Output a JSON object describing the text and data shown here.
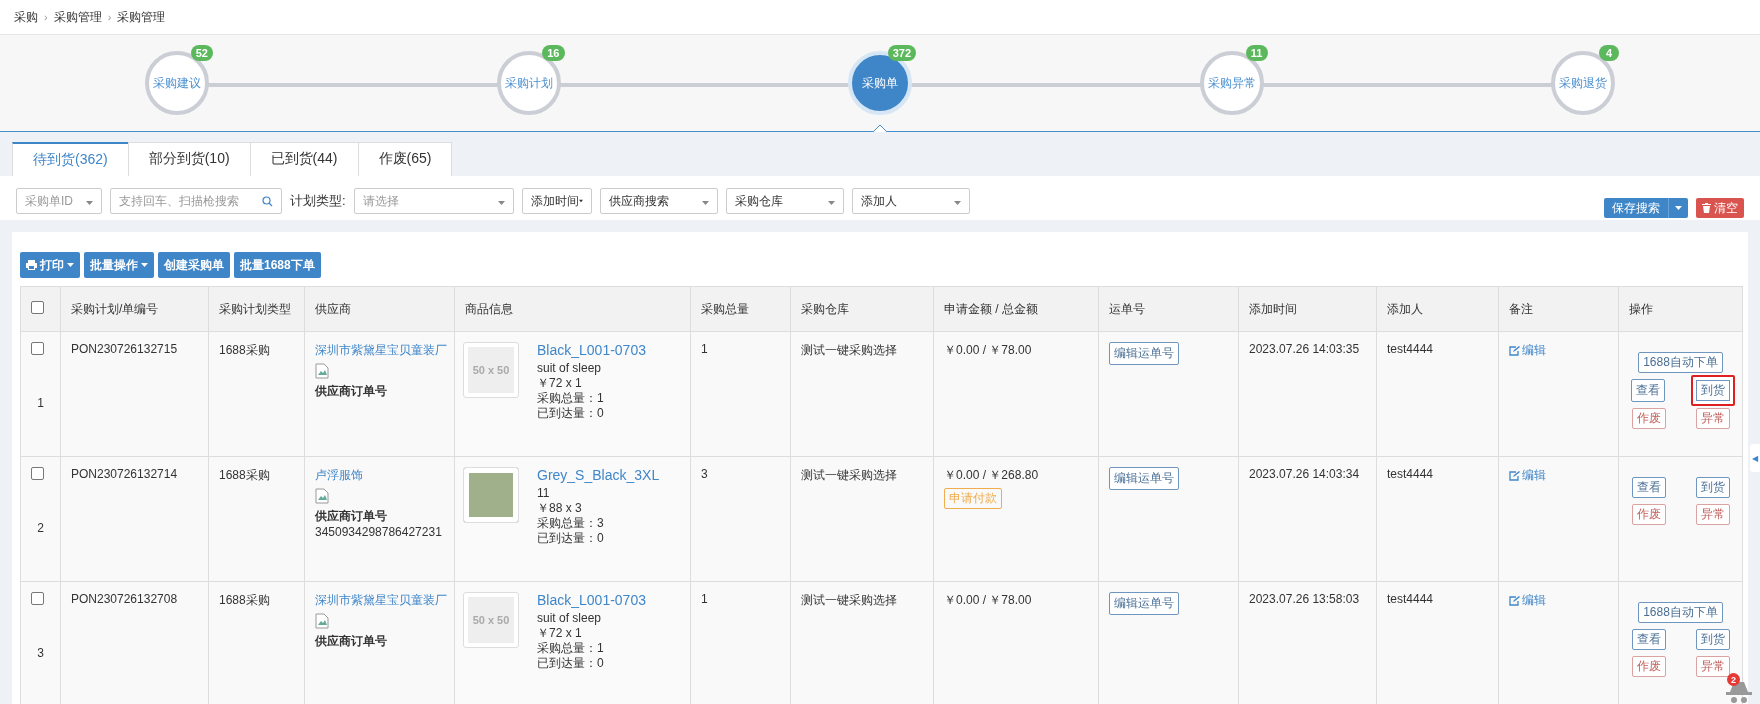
{
  "breadcrumb": [
    "采购",
    "采购管理",
    "采购管理"
  ],
  "breadcrumb_separator": "›",
  "steps": [
    {
      "label": "采购建议",
      "count": "52",
      "selected": false
    },
    {
      "label": "采购计划",
      "count": "16",
      "selected": false
    },
    {
      "label": "采购单",
      "count": "372",
      "selected": true
    },
    {
      "label": "采购异常",
      "count": "11",
      "selected": false
    },
    {
      "label": "采购退货",
      "count": "4",
      "selected": false
    }
  ],
  "tabs": [
    {
      "label": "待到货(362)",
      "selected": true
    },
    {
      "label": "部分到货(10)",
      "selected": false
    },
    {
      "label": "已到货(44)",
      "selected": false
    },
    {
      "label": "作废(65)",
      "selected": false
    }
  ],
  "filters": [
    {
      "kind": "select",
      "placeholder": "采购单ID"
    },
    {
      "kind": "search",
      "placeholder": "支持回车、扫描枪搜索"
    },
    {
      "kind": "label",
      "text": "计划类型:"
    },
    {
      "kind": "select",
      "placeholder": "请选择"
    },
    {
      "kind": "menu",
      "value": "添加时间"
    },
    {
      "kind": "select",
      "value": "供应商搜索"
    },
    {
      "kind": "select",
      "value": "采购仓库"
    },
    {
      "kind": "select",
      "value": "添加人"
    }
  ],
  "save_search": "保存搜索",
  "clear": "清空",
  "toolbar": [
    {
      "label": "打印",
      "caret": true
    },
    {
      "label": "批量操作",
      "caret": true
    },
    {
      "label": "创建采购单",
      "caret": false
    },
    {
      "label": "批量1688下单",
      "caret": false
    }
  ],
  "select_all_checked": false,
  "table": {
    "columns": [
      "采购计划/单编号",
      "采购计划类型",
      "供应商",
      "商品信息",
      "采购总量",
      "采购仓库",
      "申请金额 / 总金额",
      "运单号",
      "添加时间",
      "添加人",
      "备注",
      "操作"
    ],
    "rows": [
      {
        "checked": false,
        "index": "1",
        "number": "PON230726132715",
        "plan_type": "1688采购",
        "supplier": "深圳市紫黛星宝贝童装厂",
        "supplier_order_label": "供应商订单号",
        "product": {
          "image": {
            "kind": "placeholder",
            "label": "50 x 50"
          },
          "name": "Black_L001-0703",
          "variant": "suit of sleep",
          "price_qty": "￥72 x 1",
          "total_qty": "采购总量：1",
          "arrived_qty": "已到达量：0"
        },
        "total": "1",
        "warehouse": "测试一键采购选择",
        "amount": "￥0.00 / ￥78.00",
        "waybill": "编辑运单号",
        "time": "2023.07.26 14:03:35",
        "creator": "test4444",
        "note": "编辑",
        "actions": [
          {
            "buttons": [
              {
                "label": "1688自动下单",
                "kind": "primary",
                "highlighted": false
              }
            ]
          },
          {
            "buttons": [
              {
                "label": "查看",
                "kind": "primary",
                "highlighted": false
              },
              {
                "label": "到货",
                "kind": "primary",
                "highlighted": true
              }
            ]
          },
          {
            "buttons": [
              {
                "label": "作废",
                "kind": "danger",
                "highlighted": false
              },
              {
                "label": "异常",
                "kind": "danger",
                "highlighted": false
              }
            ]
          }
        ]
      },
      {
        "checked": false,
        "index": "2",
        "number": "PON230726132714",
        "plan_type": "1688采购",
        "supplier": "卢浮服饰",
        "supplier_order_label": "供应商订单号",
        "supplier_order_no": "3450934298786427231",
        "product": {
          "image": {
            "kind": "photo"
          },
          "name": "Grey_S_Black_3XL",
          "variant": "11",
          "price_qty": "￥88 x 3",
          "total_qty": "采购总量：3",
          "arrived_qty": "已到达量：0"
        },
        "total": "3",
        "warehouse": "测试一键采购选择",
        "amount": "￥0.00 / ￥268.80",
        "payment_tag": "申请付款",
        "waybill": "编辑运单号",
        "time": "2023.07.26 14:03:34",
        "creator": "test4444",
        "note": "编辑",
        "actions": [
          {
            "buttons": [
              {
                "label": "查看",
                "kind": "primary",
                "highlighted": false
              },
              {
                "label": "到货",
                "kind": "primary",
                "highlighted": false
              }
            ]
          },
          {
            "buttons": [
              {
                "label": "作废",
                "kind": "danger",
                "highlighted": false
              },
              {
                "label": "异常",
                "kind": "danger",
                "highlighted": false
              }
            ]
          }
        ]
      },
      {
        "checked": false,
        "index": "3",
        "number": "PON230726132708",
        "plan_type": "1688采购",
        "supplier": "深圳市紫黛星宝贝童装厂",
        "supplier_order_label": "供应商订单号",
        "product": {
          "image": {
            "kind": "placeholder",
            "label": "50 x 50"
          },
          "name": "Black_L001-0703",
          "variant": "suit of sleep",
          "price_qty": "￥72 x 1",
          "total_qty": "采购总量：1",
          "arrived_qty": "已到达量：0"
        },
        "total": "1",
        "warehouse": "测试一键采购选择",
        "amount": "￥0.00 / ￥78.00",
        "waybill": "编辑运单号",
        "time": "2023.07.26 13:58:03",
        "creator": "test4444",
        "note": "编辑",
        "actions": [
          {
            "buttons": [
              {
                "label": "1688自动下单",
                "kind": "primary",
                "highlighted": false
              }
            ]
          },
          {
            "buttons": [
              {
                "label": "查看",
                "kind": "primary",
                "highlighted": false
              },
              {
                "label": "到货",
                "kind": "primary",
                "highlighted": false
              }
            ]
          },
          {
            "buttons": [
              {
                "label": "作废",
                "kind": "danger",
                "highlighted": false
              },
              {
                "label": "异常",
                "kind": "danger",
                "highlighted": false
              }
            ]
          }
        ]
      }
    ]
  },
  "collapse_arrow": "◀",
  "helper_badge": "2"
}
